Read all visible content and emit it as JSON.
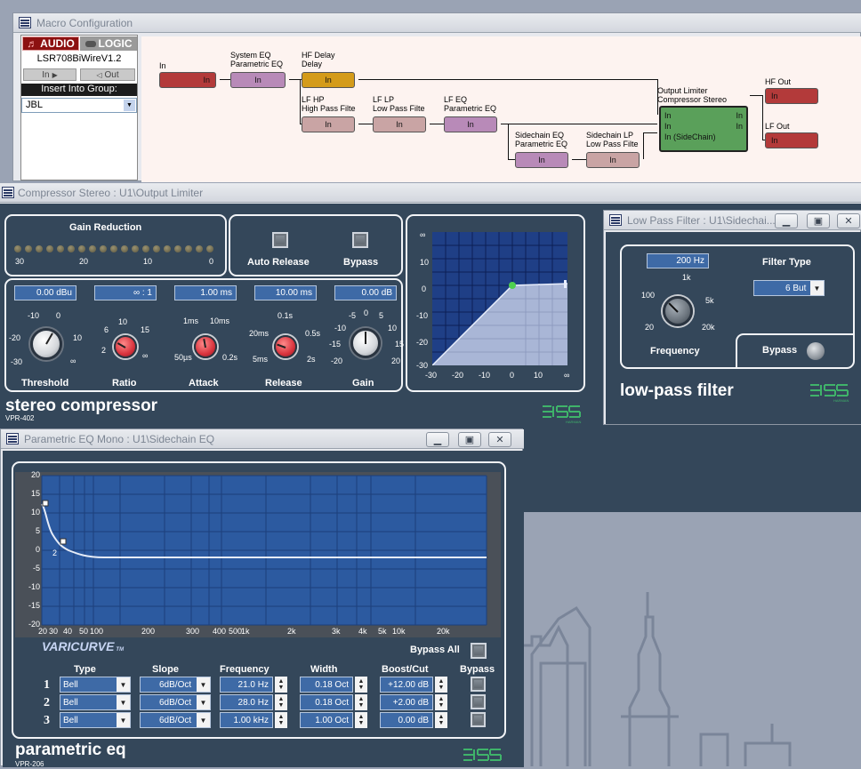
{
  "macro": {
    "title": "Macro Configuration",
    "tabs": {
      "audio": "AUDIO",
      "logic": "LOGIC"
    },
    "device_name": "LSR708BiWireV1.2",
    "io_buttons": {
      "in": "In",
      "out": "Out"
    },
    "insert_group_label": "Insert Into Group:",
    "group_value": "JBL",
    "blocks": [
      {
        "label": "In",
        "port": "In",
        "color": "#b33a3a"
      },
      {
        "label": "System EQ\nParametric EQ",
        "port": "In",
        "color": "#b88ab8"
      },
      {
        "label": "HF Delay\nDelay",
        "port": "In",
        "color": "#d49b1a"
      },
      {
        "label": "LF HP\nHigh Pass Filte",
        "port": "In",
        "color": "#c9a4a4"
      },
      {
        "label": "LF LP\nLow Pass Filte",
        "port": "In",
        "color": "#c9a4a4"
      },
      {
        "label": "LF EQ\nParametric EQ",
        "port": "In",
        "color": "#b88ab8"
      },
      {
        "label": "Sidechain EQ\nParametric EQ",
        "port": "In",
        "color": "#b88ab8"
      },
      {
        "label": "Sidechain LP\nLow Pass Filte",
        "port": "In",
        "color": "#c9a4a4"
      },
      {
        "label": "Output Limiter\nCompressor Stereo",
        "ports": [
          "In",
          "In",
          "In (SideChain)"
        ],
        "outs": [
          "In",
          "In"
        ],
        "color": "#5aa05a"
      },
      {
        "label": "HF Out",
        "port": "In",
        "color": "#b33a3a"
      },
      {
        "label": "LF Out",
        "port": "In",
        "color": "#b33a3a"
      }
    ]
  },
  "compressor": {
    "title": "Compressor Stereo : U1\\Output Limiter",
    "gain_reduction_label": "Gain Reduction",
    "gr_scale": [
      "30",
      "20",
      "10",
      "0"
    ],
    "auto_release_label": "Auto Release",
    "bypass_label": "Bypass",
    "params": [
      {
        "name": "Threshold",
        "value": "0.00 dBu",
        "ticks": [
          "-10",
          "0",
          "-20",
          "10",
          "-30",
          "∞"
        ]
      },
      {
        "name": "Ratio",
        "value": "∞ : 1",
        "ticks": [
          "10",
          "6",
          "15",
          "2",
          "∞"
        ]
      },
      {
        "name": "Attack",
        "value": "1.00 ms",
        "ticks": [
          "1ms",
          "10ms",
          "50µs",
          "0.2s"
        ]
      },
      {
        "name": "Release",
        "value": "10.00 ms",
        "ticks": [
          "0.1s",
          "20ms",
          "0.5s",
          "5ms",
          "2s"
        ]
      },
      {
        "name": "Gain",
        "value": "0.00 dB",
        "ticks": [
          "-5",
          "0",
          "5",
          "-10",
          "10",
          "-15",
          "15",
          "-20",
          "20"
        ]
      }
    ],
    "graph_y": [
      "∞",
      "10",
      "0",
      "-10",
      "-20",
      "-30"
    ],
    "graph_x": [
      "-30",
      "-20",
      "-10",
      "0",
      "10",
      "∞"
    ],
    "product_name": "stereo compressor",
    "model": "VPR-402"
  },
  "lowpass": {
    "title": "Low Pass Filter : U1\\Sidechai...",
    "frequency_value": "200 Hz",
    "frequency_label": "Frequency",
    "freq_ticks": [
      "1k",
      "100",
      "5k",
      "20",
      "20k"
    ],
    "filter_type_label": "Filter Type",
    "filter_type_value": "6 But",
    "bypass_label": "Bypass",
    "product_name": "low-pass filter"
  },
  "peq": {
    "title": "Parametric EQ Mono : U1\\Sidechain EQ",
    "y_ticks": [
      "20",
      "15",
      "10",
      "5",
      "0",
      "-5",
      "-10",
      "-15",
      "-20"
    ],
    "x_ticks": [
      "20",
      "30",
      "40",
      "50",
      "100",
      "200",
      "300",
      "400",
      "500",
      "1k",
      "2k",
      "3k",
      "4k",
      "5k",
      "10k",
      "20k"
    ],
    "curve_label": "VARICURVE",
    "tm": "TM",
    "bypass_all_label": "Bypass All",
    "headers": {
      "type": "Type",
      "slope": "Slope",
      "frequency": "Frequency",
      "width": "Width",
      "boost": "Boost/Cut",
      "bypass": "Bypass"
    },
    "bands": [
      {
        "num": "1",
        "type": "Bell",
        "slope": "6dB/Oct",
        "frequency": "21.0 Hz",
        "width": "0.18 Oct",
        "boost": "+12.00 dB"
      },
      {
        "num": "2",
        "type": "Bell",
        "slope": "6dB/Oct",
        "frequency": "28.0 Hz",
        "width": "0.18 Oct",
        "boost": "+2.00 dB"
      },
      {
        "num": "3",
        "type": "Bell",
        "slope": "6dB/Oct",
        "frequency": "1.00 kHz",
        "width": "1.00 Oct",
        "boost": "0.00 dB"
      }
    ],
    "marker_label": "2",
    "product_name": "parametric eq",
    "model": "VPR-206"
  },
  "winbuttons": {
    "minimize": "▁",
    "restore": "▣",
    "close": "✕"
  }
}
